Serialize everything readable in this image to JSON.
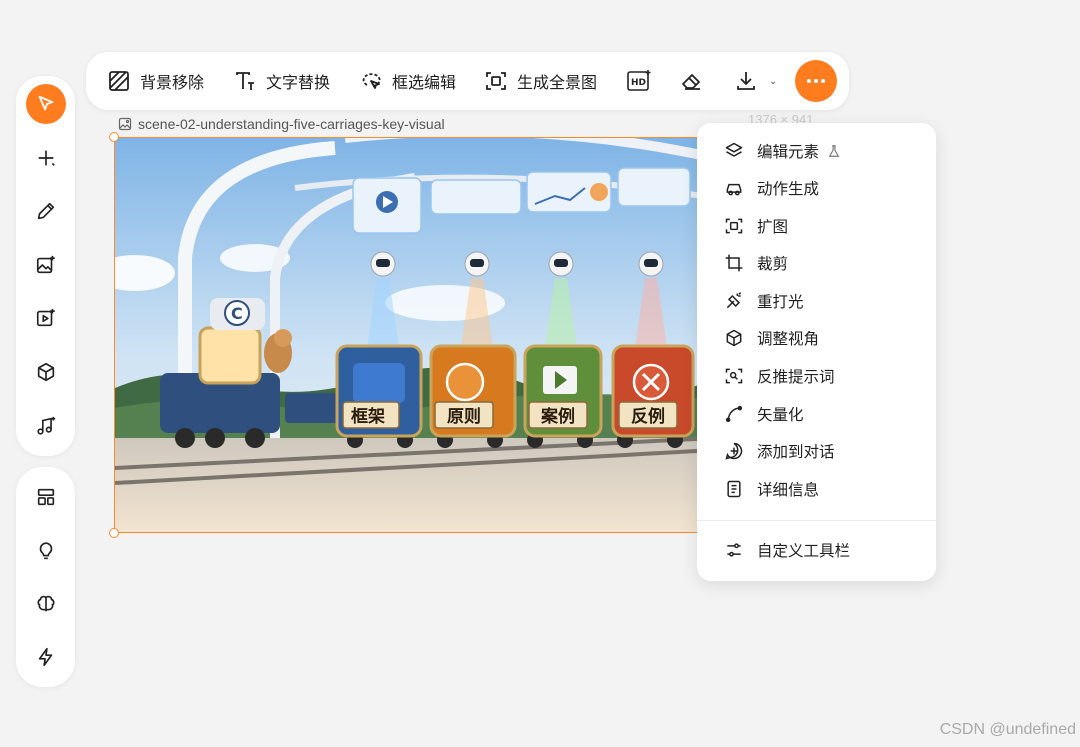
{
  "toolbar": {
    "remove_bg": "背景移除",
    "text_replace": "文字替换",
    "select_edit": "框选编辑",
    "panorama": "生成全景图"
  },
  "file": {
    "name": "scene-02-understanding-five-carriages-key-visual",
    "dimensions": "1376 × 941"
  },
  "scene": {
    "car1": "框架",
    "car2": "原则",
    "car3": "案例",
    "car4": "反例",
    "engine_letter": "C"
  },
  "menu": {
    "items": [
      "编辑元素",
      "动作生成",
      "扩图",
      "裁剪",
      "重打光",
      "调整视角",
      "反推提示词",
      "矢量化",
      "添加到对话",
      "详细信息"
    ],
    "customize": "自定义工具栏"
  },
  "watermark": "CSDN @undefined",
  "colors": {
    "accent": "#ff7d1f",
    "selection": "#ff8a2a"
  }
}
